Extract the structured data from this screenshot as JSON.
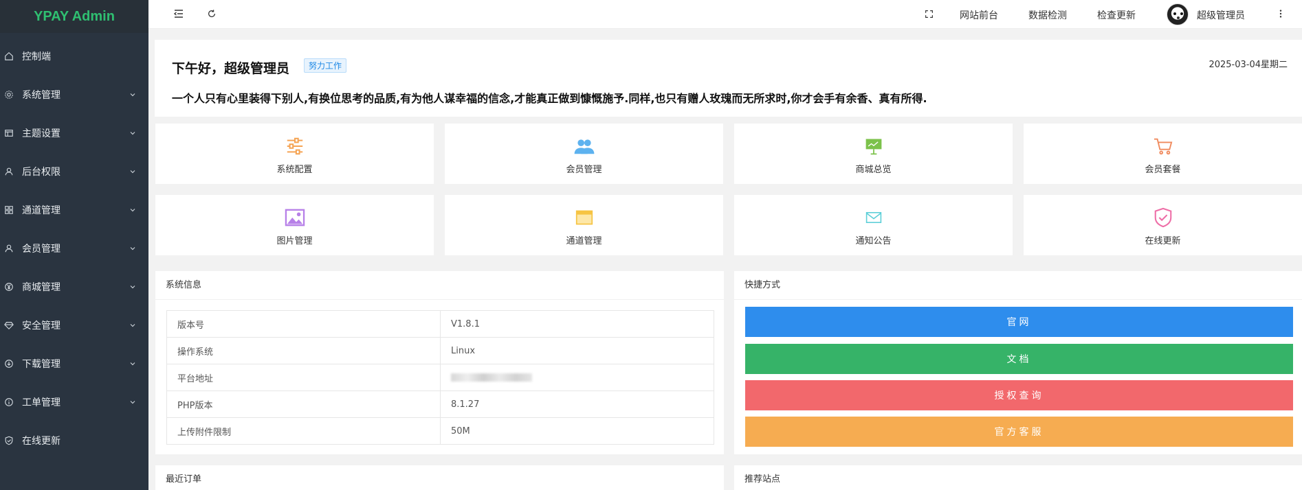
{
  "app": {
    "logo": "YPAY Admin"
  },
  "sidebar": {
    "items": [
      {
        "label": "控制端",
        "icon": "home-icon",
        "expandable": false
      },
      {
        "label": "系统管理",
        "icon": "gear-icon",
        "expandable": true
      },
      {
        "label": "主题设置",
        "icon": "layout-icon",
        "expandable": true
      },
      {
        "label": "后台权限",
        "icon": "user-icon",
        "expandable": true
      },
      {
        "label": "通道管理",
        "icon": "apps-icon",
        "expandable": true
      },
      {
        "label": "会员管理",
        "icon": "user-icon",
        "expandable": true
      },
      {
        "label": "商城管理",
        "icon": "yen-icon",
        "expandable": true
      },
      {
        "label": "安全管理",
        "icon": "diamond-icon",
        "expandable": true
      },
      {
        "label": "下载管理",
        "icon": "download-icon",
        "expandable": true
      },
      {
        "label": "工单管理",
        "icon": "info-icon",
        "expandable": true
      },
      {
        "label": "在线更新",
        "icon": "shield-check-icon",
        "expandable": false
      }
    ]
  },
  "topbar": {
    "links": [
      "网站前台",
      "数据检测",
      "检查更新"
    ],
    "user_name": "超级管理员"
  },
  "greeting": {
    "title": "下午好，超级管理员",
    "badge": "努力工作",
    "date": "2025-03-04星期二",
    "quote": "一个人只有心里装得下别人,有换位思考的品质,有为他人谋幸福的信念,才能真正做到慷慨施予.同样,也只有赠人玫瑰而无所求时,你才会手有余香、真有所得."
  },
  "tiles": [
    {
      "label": "系统配置",
      "icon": "sliders-icon",
      "color": "#f5a454"
    },
    {
      "label": "会员管理",
      "icon": "users-icon",
      "color": "#5db2ef"
    },
    {
      "label": "商城总览",
      "icon": "presentation-icon",
      "color": "#7cc24b"
    },
    {
      "label": "会员套餐",
      "icon": "cart-icon",
      "color": "#f08a5d"
    },
    {
      "label": "图片管理",
      "icon": "image-icon",
      "color": "#b780e8"
    },
    {
      "label": "通道管理",
      "icon": "window-icon",
      "color": "#f6c443"
    },
    {
      "label": "通知公告",
      "icon": "mail-icon",
      "color": "#5dcfd8"
    },
    {
      "label": "在线更新",
      "icon": "shield-check-icon",
      "color": "#ee6ea7"
    }
  ],
  "sysinfo": {
    "title": "系统信息",
    "rows": [
      {
        "key": "版本号",
        "value": "V1.8.1"
      },
      {
        "key": "操作系统",
        "value": "Linux"
      },
      {
        "key": "平台地址",
        "value": ""
      },
      {
        "key": "PHP版本",
        "value": "8.1.27"
      },
      {
        "key": "上传附件限制",
        "value": "50M"
      }
    ]
  },
  "quick": {
    "title": "快捷方式",
    "buttons": [
      {
        "label": "官网",
        "color": "#2e8ded"
      },
      {
        "label": "文档",
        "color": "#36b368"
      },
      {
        "label": "授权查询",
        "color": "#f2686c"
      },
      {
        "label": "官方客服",
        "color": "#f6ac51"
      }
    ]
  },
  "bottom": {
    "orders_title": "最近订单",
    "sites_title": "推荐站点"
  }
}
